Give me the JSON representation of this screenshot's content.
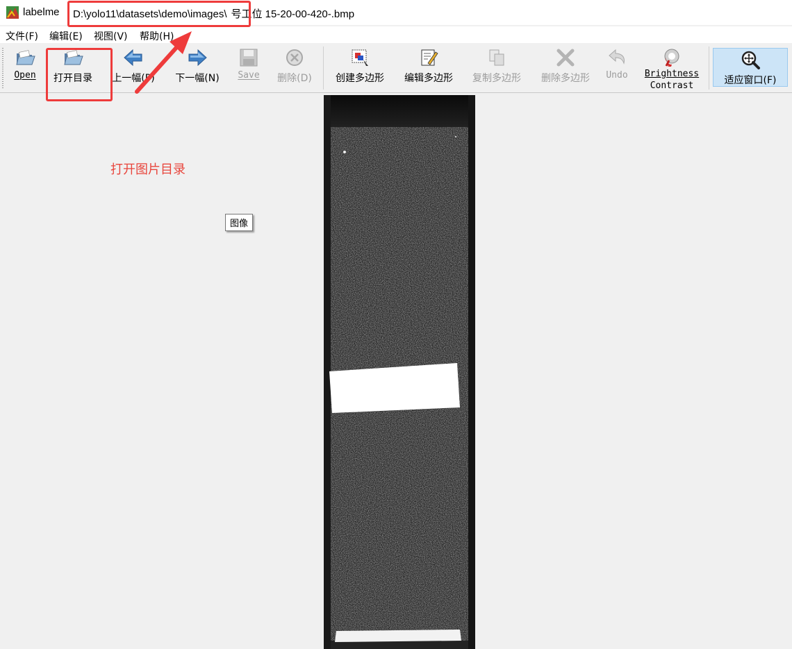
{
  "window": {
    "app_name": "labelme",
    "file_path_highlighted": "D:\\yolo11\\datasets\\demo\\images\\",
    "file_name_rest": "号工位 15-20-00-420-.bmp"
  },
  "menu": {
    "items": [
      {
        "label": "文件(F)"
      },
      {
        "label": "编辑(E)"
      },
      {
        "label": "视图(V)"
      },
      {
        "label": "帮助(H)"
      }
    ]
  },
  "toolbar": {
    "open": {
      "label": "Open",
      "icon": "folder-open-icon",
      "enabled": true
    },
    "open_dir": {
      "label": "打开目录",
      "icon": "folder-open-icon",
      "enabled": true
    },
    "prev": {
      "label": "上一幅(P)",
      "icon": "arrow-left-icon",
      "enabled": true
    },
    "next": {
      "label": "下一幅(N)",
      "icon": "arrow-right-icon",
      "enabled": true
    },
    "save": {
      "label": "Save",
      "icon": "save-icon",
      "enabled": false
    },
    "delete_file": {
      "label": "删除(D)",
      "icon": "delete-circle-icon",
      "enabled": false
    },
    "create_polygon": {
      "label": "创建多边形",
      "icon": "create-polygon-icon",
      "enabled": true
    },
    "edit_polygon": {
      "label": "编辑多边形",
      "icon": "edit-polygon-icon",
      "enabled": true
    },
    "copy_polygon": {
      "label": "复制多边形",
      "icon": "copy-icon",
      "enabled": false
    },
    "delete_polygon": {
      "label": "删除多边形",
      "icon": "delete-x-icon",
      "enabled": false
    },
    "undo": {
      "label": "Undo",
      "icon": "undo-icon",
      "enabled": false
    },
    "brightness_line1": "Brightness",
    "brightness_line2": "Contrast",
    "fit_window": {
      "label": "适应窗口(F)",
      "icon": "fit-window-icon",
      "enabled": true,
      "active": true
    }
  },
  "canvas": {
    "tooltip": "图像",
    "annotation_text": "打开图片目录"
  },
  "colors": {
    "highlight": "#ee3b3b",
    "annotation": "#e8453c",
    "active_tool_bg": "#cce4f7"
  }
}
